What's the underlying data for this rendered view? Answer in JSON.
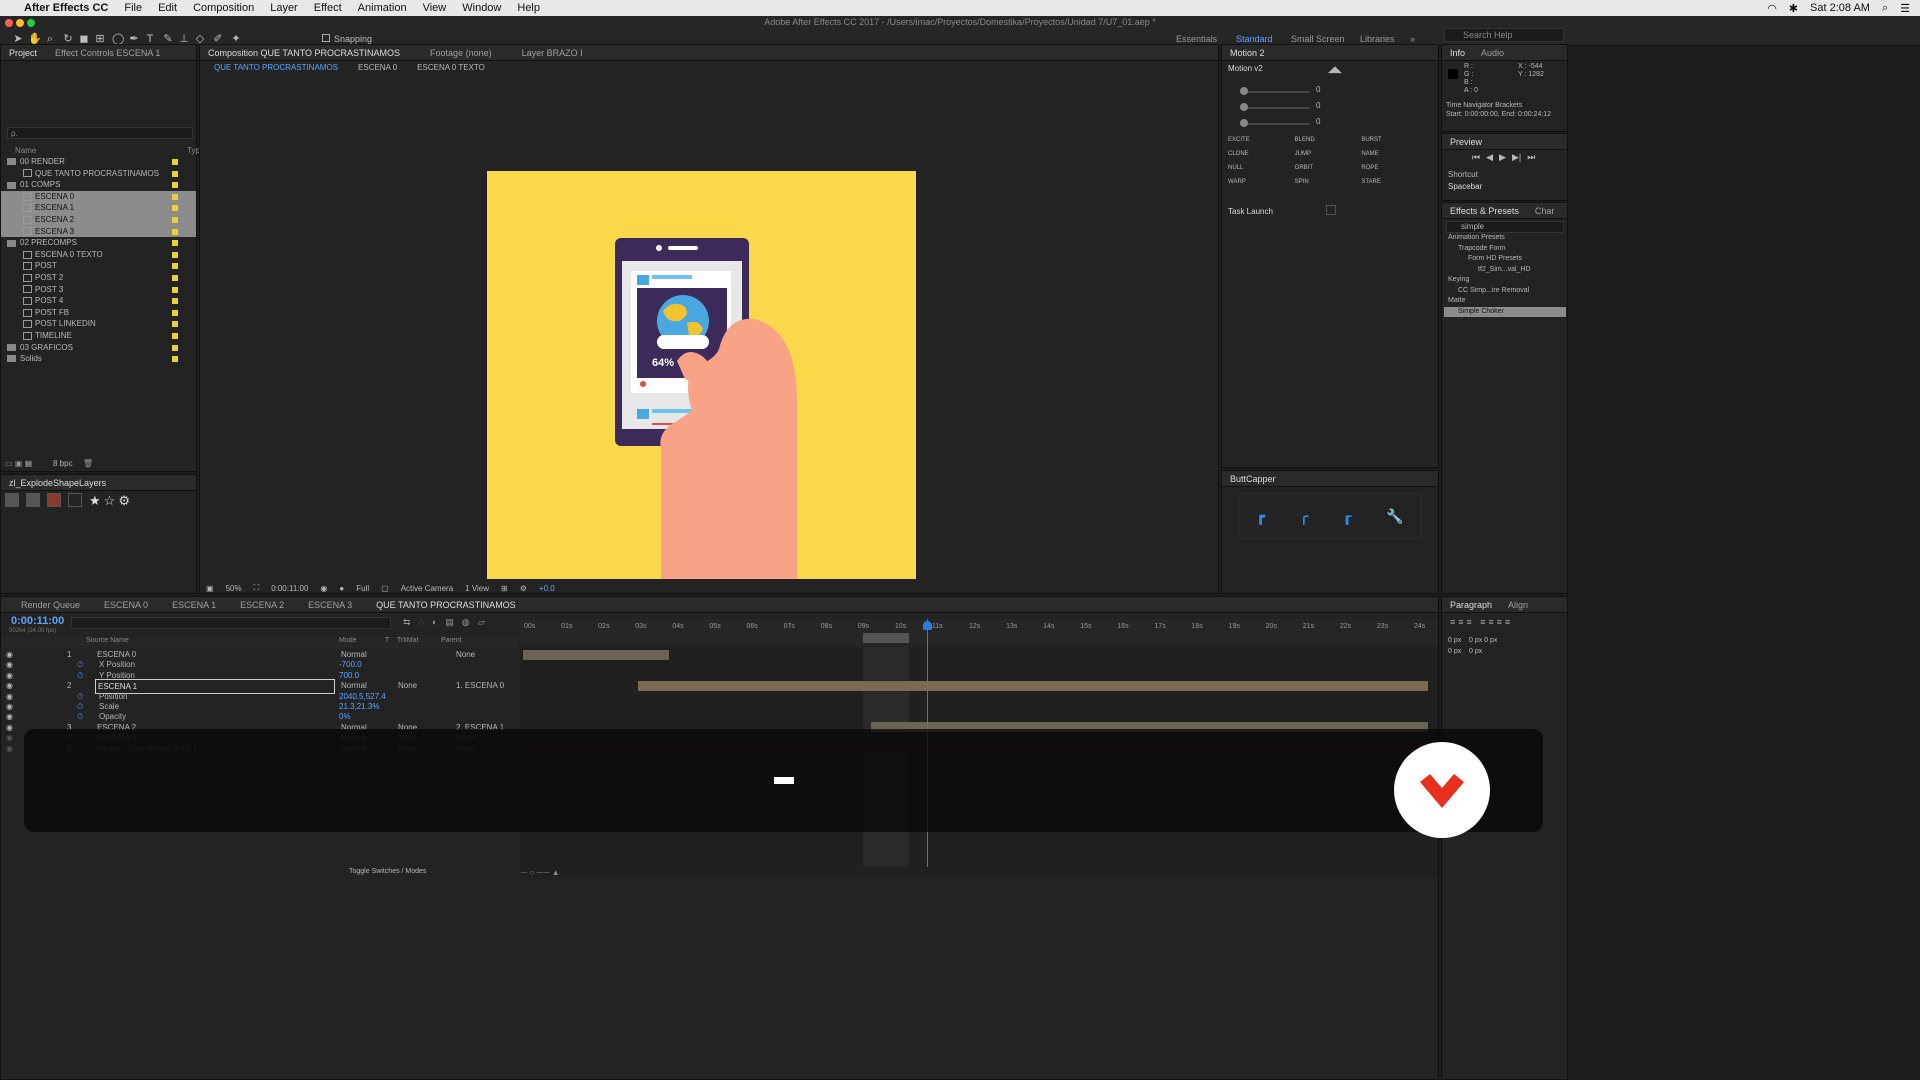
{
  "menubar": {
    "app": "After Effects CC",
    "items": [
      "File",
      "Edit",
      "Composition",
      "Layer",
      "Effect",
      "Animation",
      "View",
      "Window",
      "Help"
    ],
    "clock": "Sat 2:08 AM"
  },
  "window_title": "Adobe After Effects CC 2017 - /Users/imac/Proyectos/Domestika/Proyectos/Unidad 7/U7_01.aep *",
  "toolbar": {
    "snapping": "Snapping",
    "workspaces": [
      "Essentials",
      "Standard",
      "Small Screen",
      "Libraries"
    ],
    "active_workspace": "Standard",
    "search_placeholder": "Search Help"
  },
  "project": {
    "tabs": [
      "Project",
      "Effect Controls ESCENA 1"
    ],
    "search_placeholder": "ρ.",
    "col_name": "Name",
    "col_type": "Typ",
    "items": [
      {
        "label": "00 RENDER",
        "kind": "folder",
        "level": 0
      },
      {
        "label": "QUE TANTO PROCRASTINAMOS",
        "kind": "comp",
        "level": 1
      },
      {
        "label": "01 COMPS",
        "kind": "folder",
        "level": 0
      },
      {
        "label": "ESCENA 0",
        "kind": "comp",
        "level": 1,
        "selected": true
      },
      {
        "label": "ESCENA 1",
        "kind": "comp",
        "level": 1,
        "selected": true
      },
      {
        "label": "ESCENA 2",
        "kind": "comp",
        "level": 1,
        "selected": true
      },
      {
        "label": "ESCENA 3",
        "kind": "comp",
        "level": 1,
        "selected": true
      },
      {
        "label": "02 PRECOMPS",
        "kind": "folder",
        "level": 0
      },
      {
        "label": "ESCENA 0 TEXTO",
        "kind": "comp",
        "level": 1
      },
      {
        "label": "POST",
        "kind": "comp",
        "level": 1
      },
      {
        "label": "POST 2",
        "kind": "comp",
        "level": 1
      },
      {
        "label": "POST 3",
        "kind": "comp",
        "level": 1
      },
      {
        "label": "POST 4",
        "kind": "comp",
        "level": 1
      },
      {
        "label": "POST FB",
        "kind": "comp",
        "level": 1
      },
      {
        "label": "POST LINKEDIN",
        "kind": "comp",
        "level": 1
      },
      {
        "label": "TIMELINE",
        "kind": "comp",
        "level": 1
      },
      {
        "label": "03 GRAFICOS",
        "kind": "folder",
        "level": 0
      },
      {
        "label": "Solids",
        "kind": "folder",
        "level": 0
      }
    ],
    "bpc": "8 bpc"
  },
  "explode": {
    "title": "zl_ExplodeShapeLayers"
  },
  "composition": {
    "tabs": [
      "Composition QUE TANTO PROCRASTINAMOS",
      "Footage (none)",
      "Layer BRAZO I"
    ],
    "breadcrumbs": [
      "QUE TANTO PROCRASTINAMOS",
      "ESCENA 0",
      "ESCENA 0 TEXTO"
    ],
    "canvas_bg": "#f9d94a",
    "percent_text": "64%",
    "footer": {
      "zoom": "50%",
      "time": "0:00:11:00",
      "resolution": "Full",
      "camera": "Active Camera",
      "views": "1 View",
      "exposure": "+0.0"
    }
  },
  "motion": {
    "title": "Motion 2",
    "preset": "Motion v2",
    "sliders": [
      "0",
      "0",
      "0"
    ],
    "buttons": [
      "EXCITE",
      "BLEND",
      "BURST",
      "CLONE",
      "JUMP",
      "NAME",
      "NULL",
      "ORBIT",
      "ROPE",
      "WARP",
      "SPIN",
      "STARE"
    ],
    "task": "Task Launch"
  },
  "info": {
    "tabs": [
      "Info",
      "Audio"
    ],
    "r": "R :",
    "g": "G :",
    "b": "B :",
    "a": "A : 0",
    "x": "X : -544",
    "y": "Y : 1282",
    "nav_title": "Time Navigator Brackets",
    "nav_range": "Start: 0:00:00:00, End: 0:00:24:12"
  },
  "preview": {
    "title": "Preview",
    "shortcut_label": "Shortcut",
    "shortcut": "Spacebar"
  },
  "effects": {
    "tabs": [
      "Effects & Presets",
      "Char"
    ],
    "search": "simple",
    "tree": [
      {
        "label": "Animation Presets",
        "level": 0
      },
      {
        "label": "Trapcode Form",
        "level": 1
      },
      {
        "label": "Form HD Presets",
        "level": 2
      },
      {
        "label": "tf2_Sim...val_HD",
        "level": 3
      },
      {
        "label": "Keying",
        "level": 0
      },
      {
        "label": "CC Simp...ire Removal",
        "level": 1
      },
      {
        "label": "Matte",
        "level": 0
      },
      {
        "label": "Simple Choker",
        "level": 1,
        "selected": true
      }
    ]
  },
  "buttcapper": {
    "title": "ButtCapper"
  },
  "paragraph": {
    "tabs": [
      "Paragraph",
      "Align"
    ],
    "values": [
      "0 px",
      "0 px",
      "0 px",
      "0 px",
      "0 px"
    ]
  },
  "timeline": {
    "tabs": [
      "Render Queue",
      "ESCENA 0",
      "ESCENA 1",
      "ESCENA 2",
      "ESCENA 3",
      "QUE TANTO PROCRASTINAMOS"
    ],
    "current_time": "0:00:11:00",
    "fps": "00264 (24.00 fps)",
    "headers": {
      "source": "Source Name",
      "mode": "Mode",
      "t": "T",
      "trkmat": "TrkMat",
      "parent": "Parent"
    },
    "ruler": [
      "00s",
      "01s",
      "02s",
      "03s",
      "04s",
      "05s",
      "06s",
      "07s",
      "08s",
      "09s",
      "10s",
      "11s",
      "12s",
      "13s",
      "14s",
      "15s",
      "16s",
      "17s",
      "18s",
      "19s",
      "20s",
      "21s",
      "22s",
      "23s",
      "24s"
    ],
    "layers": [
      {
        "num": "1",
        "name": "ESCENA 0",
        "mode": "Normal",
        "trkmat": "",
        "parent": "None"
      },
      {
        "num": "",
        "name": "X Position",
        "value": "-700.0",
        "prop": true
      },
      {
        "num": "",
        "name": "Y Position",
        "value": "700.0",
        "prop": true
      },
      {
        "num": "2",
        "name": "ESCENA 1",
        "mode": "Normal",
        "trkmat": "None",
        "parent": "1. ESCENA 0",
        "selected": true
      },
      {
        "num": "",
        "name": "Position",
        "value": "2040.5,527.4",
        "prop": true
      },
      {
        "num": "",
        "name": "Scale",
        "value": "21.3,21.3%",
        "prop": true
      },
      {
        "num": "",
        "name": "Opacity",
        "value": "0%",
        "prop": true
      },
      {
        "num": "3",
        "name": "ESCENA 2",
        "mode": "Normal",
        "trkmat": "None",
        "parent": "2. ESCENA 1"
      },
      {
        "num": "4",
        "name": "ESCENA 3",
        "mode": "Normal",
        "trkmat": "None",
        "parent": "None"
      },
      {
        "num": "5",
        "name": "Medium Gray-Purple Solid 1",
        "mode": "Normal",
        "trkmat": "None",
        "parent": "None"
      }
    ],
    "toggle": "Toggle Switches / Modes"
  }
}
